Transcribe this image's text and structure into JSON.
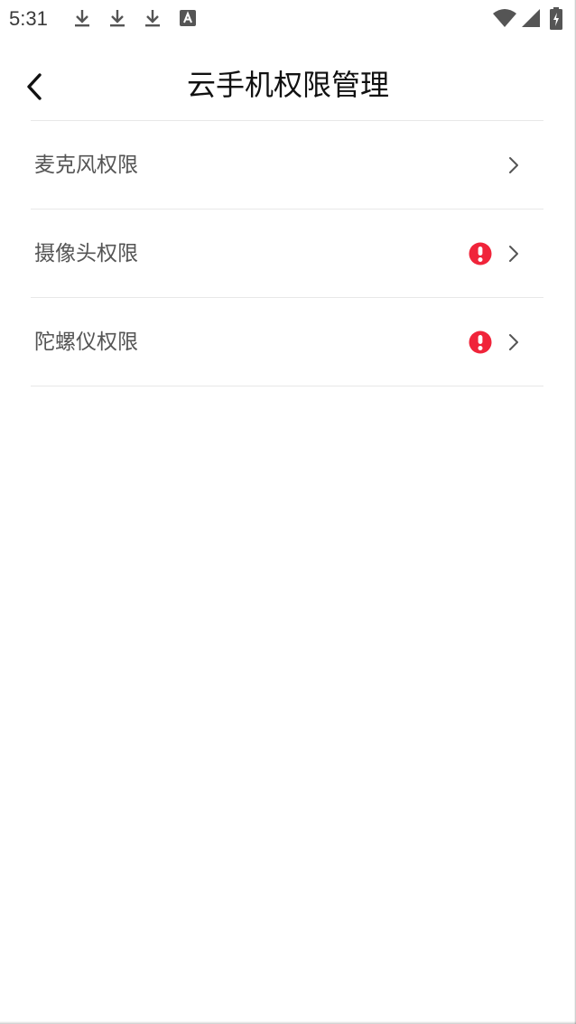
{
  "status_bar": {
    "time": "5:31",
    "icons": [
      "download-icon",
      "download-icon",
      "download-icon",
      "app-a-icon",
      "wifi-icon",
      "signal-icon",
      "battery-icon"
    ]
  },
  "header": {
    "title": "云手机权限管理",
    "back_icon": "back-arrow-icon"
  },
  "list": {
    "items": [
      {
        "label": "麦克风权限",
        "warning": false
      },
      {
        "label": "摄像头权限",
        "warning": true
      },
      {
        "label": "陀螺仪权限",
        "warning": true
      }
    ]
  },
  "colors": {
    "warning": "#f0243a",
    "title": "#111111",
    "label": "#555555",
    "divider": "#e8e8e8",
    "chevron": "#555555"
  }
}
